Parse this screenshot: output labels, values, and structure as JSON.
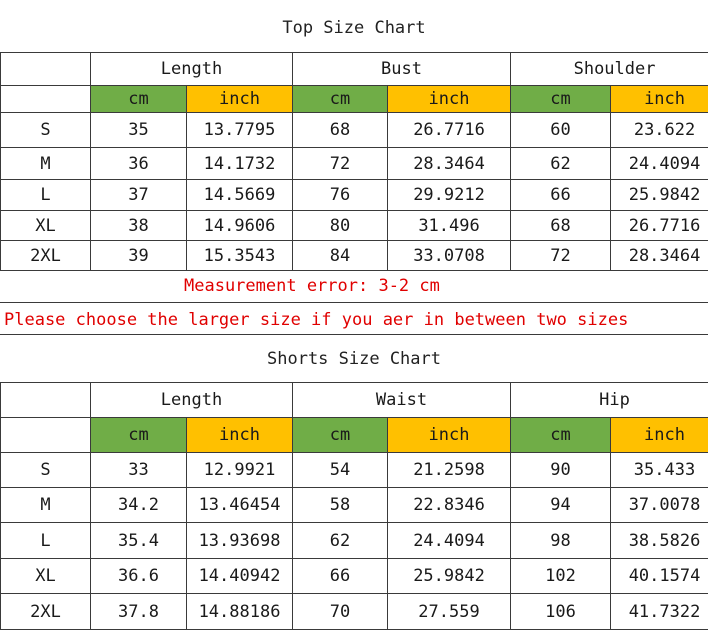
{
  "top_chart": {
    "title": "Top Size Chart",
    "groups": [
      "Length",
      "Bust",
      "Shoulder"
    ],
    "units": [
      "cm",
      "inch",
      "cm",
      "inch",
      "cm",
      "inch"
    ],
    "rows": [
      {
        "size": "S",
        "values": [
          "35",
          "13.7795",
          "68",
          "26.7716",
          "60",
          "23.622"
        ]
      },
      {
        "size": "M",
        "values": [
          "36",
          "14.1732",
          "72",
          "28.3464",
          "62",
          "24.4094"
        ]
      },
      {
        "size": "L",
        "values": [
          "37",
          "14.5669",
          "76",
          "29.9212",
          "66",
          "25.9842"
        ]
      },
      {
        "size": "XL",
        "values": [
          "38",
          "14.9606",
          "80",
          "31.496",
          "68",
          "26.7716"
        ]
      },
      {
        "size": "2XL",
        "values": [
          "39",
          "15.3543",
          "84",
          "33.0708",
          "72",
          "28.3464"
        ]
      }
    ]
  },
  "notes": {
    "measurement_error": "Measurement error: 3-2 cm",
    "advice": "Please choose the larger size if you aer in between two sizes"
  },
  "shorts_chart": {
    "title": "Shorts Size Chart",
    "groups": [
      "Length",
      "Waist",
      "Hip"
    ],
    "units": [
      "cm",
      "inch",
      "cm",
      "inch",
      "cm",
      "inch"
    ],
    "rows": [
      {
        "size": "S",
        "values": [
          "33",
          "12.9921",
          "54",
          "21.2598",
          "90",
          "35.433"
        ]
      },
      {
        "size": "M",
        "values": [
          "34.2",
          "13.46454",
          "58",
          "22.8346",
          "94",
          "37.0078"
        ]
      },
      {
        "size": "L",
        "values": [
          "35.4",
          "13.93698",
          "62",
          "24.4094",
          "98",
          "38.5826"
        ]
      },
      {
        "size": "XL",
        "values": [
          "36.6",
          "14.40942",
          "66",
          "25.9842",
          "102",
          "40.1574"
        ]
      },
      {
        "size": "2XL",
        "values": [
          "37.8",
          "14.88186",
          "70",
          "27.559",
          "106",
          "41.7322"
        ]
      }
    ]
  },
  "colors": {
    "cm_header": "#70ad47",
    "inch_header": "#ffc000",
    "note_text": "#e00000"
  }
}
